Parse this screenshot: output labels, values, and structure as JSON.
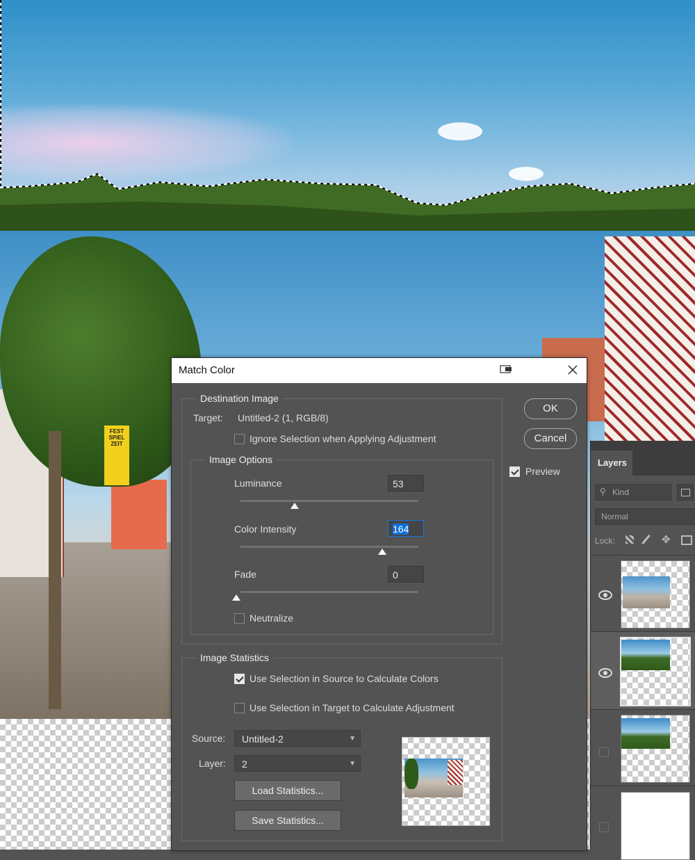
{
  "dialog": {
    "title": "Match Color",
    "destination": {
      "legend": "Destination Image",
      "target_label": "Target:",
      "target_value": "Untitled-2 (1, RGB/8)",
      "ignore_selection_label": "Ignore Selection when Applying Adjustment",
      "ignore_selection_checked": false
    },
    "image_options": {
      "legend": "Image Options",
      "luminance": {
        "label": "Luminance",
        "value": "53",
        "level": 0.33
      },
      "color_intensity": {
        "label": "Color Intensity",
        "value": "164",
        "level": 0.82
      },
      "fade": {
        "label": "Fade",
        "value": "0",
        "level": 0.0
      },
      "neutralize_label": "Neutralize",
      "neutralize_checked": false
    },
    "image_statistics": {
      "legend": "Image Statistics",
      "use_source_selection_label": "Use Selection in Source to Calculate Colors",
      "use_source_selection_checked": true,
      "use_target_selection_label": "Use Selection in Target to Calculate Adjustment",
      "use_target_selection_checked": false,
      "source_label": "Source:",
      "source_value": "Untitled-2",
      "layer_label": "Layer:",
      "layer_value": "2",
      "load_label": "Load Statistics...",
      "save_label": "Save Statistics..."
    },
    "ok_label": "OK",
    "cancel_label": "Cancel",
    "preview_label": "Preview",
    "preview_checked": true
  },
  "layers_panel": {
    "tab_label": "Layers",
    "kind_label": "Kind",
    "blend_mode": "Normal",
    "lock_label": "Lock:"
  },
  "canvas": {
    "sign_text": "FEST SPIEL ZEIT"
  },
  "colors": {
    "dialog_bg": "#535353",
    "selection_blue": "#0f6fd9"
  }
}
